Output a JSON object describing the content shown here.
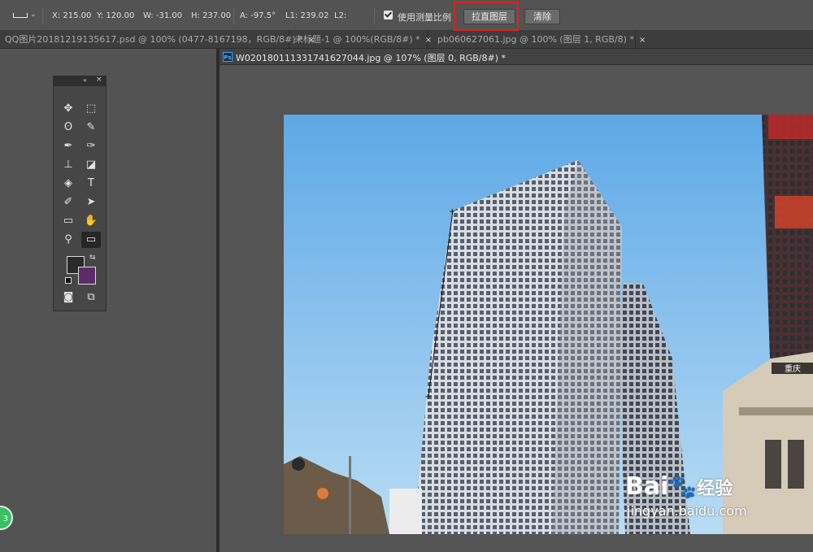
{
  "options_bar": {
    "x": "X: 215.00",
    "y": "Y: 120.00",
    "w": "W: -31.00",
    "h": "H: 237.00",
    "a": "A: -97.5°",
    "l1": "L1: 239.02",
    "l2": "L2:",
    "use_scale_label": "使用测量比例",
    "use_scale_checked": true,
    "straighten_label": "拉直图层",
    "clear_label": "清除",
    "highlight_color": "#e02020"
  },
  "tabs": [
    {
      "label": "QQ图片20181219135617.psd @ 100% (0477-8167198，RGB/8#) *",
      "close": "×"
    },
    {
      "label": "未标题-1 @ 100%(RGB/8#) *",
      "close": "×"
    },
    {
      "label": "pb060627061.jpg @ 100% (图层 1, RGB/8) *",
      "close": "×"
    }
  ],
  "document": {
    "app_icon": "Ps",
    "title": "W0201801113317416270​44.jpg @ 107% (图层 0, RGB/8#) *"
  },
  "photo": {
    "watermark_brand": "Bai",
    "watermark_brand_cn": "经验",
    "watermark_url": "jingyan.baidu.com",
    "sign_text": "重庆"
  },
  "badge": {
    "text": "3"
  },
  "colors": {
    "foreground": "#2a2a2a",
    "background": "#5b2c6b",
    "sky_top": "#5ea8e6",
    "sky_bottom": "#b8dcf4"
  },
  "tools": [
    {
      "name": "move-tool",
      "glyph": "✥"
    },
    {
      "name": "marquee-tool",
      "glyph": "⬚"
    },
    {
      "name": "lasso-tool",
      "glyph": "ʘ"
    },
    {
      "name": "quick-select-tool",
      "glyph": "✎"
    },
    {
      "name": "eyedropper-tool",
      "glyph": "✒"
    },
    {
      "name": "brush-tool",
      "glyph": "✑"
    },
    {
      "name": "stamp-tool",
      "glyph": "⊥"
    },
    {
      "name": "eraser-tool",
      "glyph": "◪"
    },
    {
      "name": "fill-tool",
      "glyph": "◈"
    },
    {
      "name": "type-tool",
      "glyph": "T"
    },
    {
      "name": "pen-tool",
      "glyph": "✐"
    },
    {
      "name": "select-arrow-tool",
      "glyph": "➤"
    },
    {
      "name": "rect-tool",
      "glyph": "▭"
    },
    {
      "name": "hand-tool",
      "glyph": "✋"
    },
    {
      "name": "zoom-tool",
      "glyph": "⚲"
    },
    {
      "name": "ruler-tool",
      "glyph": "▭"
    },
    {
      "name": "quick-mask-tool",
      "glyph": "◙"
    },
    {
      "name": "screen-mode-tool",
      "glyph": "⧉"
    }
  ]
}
